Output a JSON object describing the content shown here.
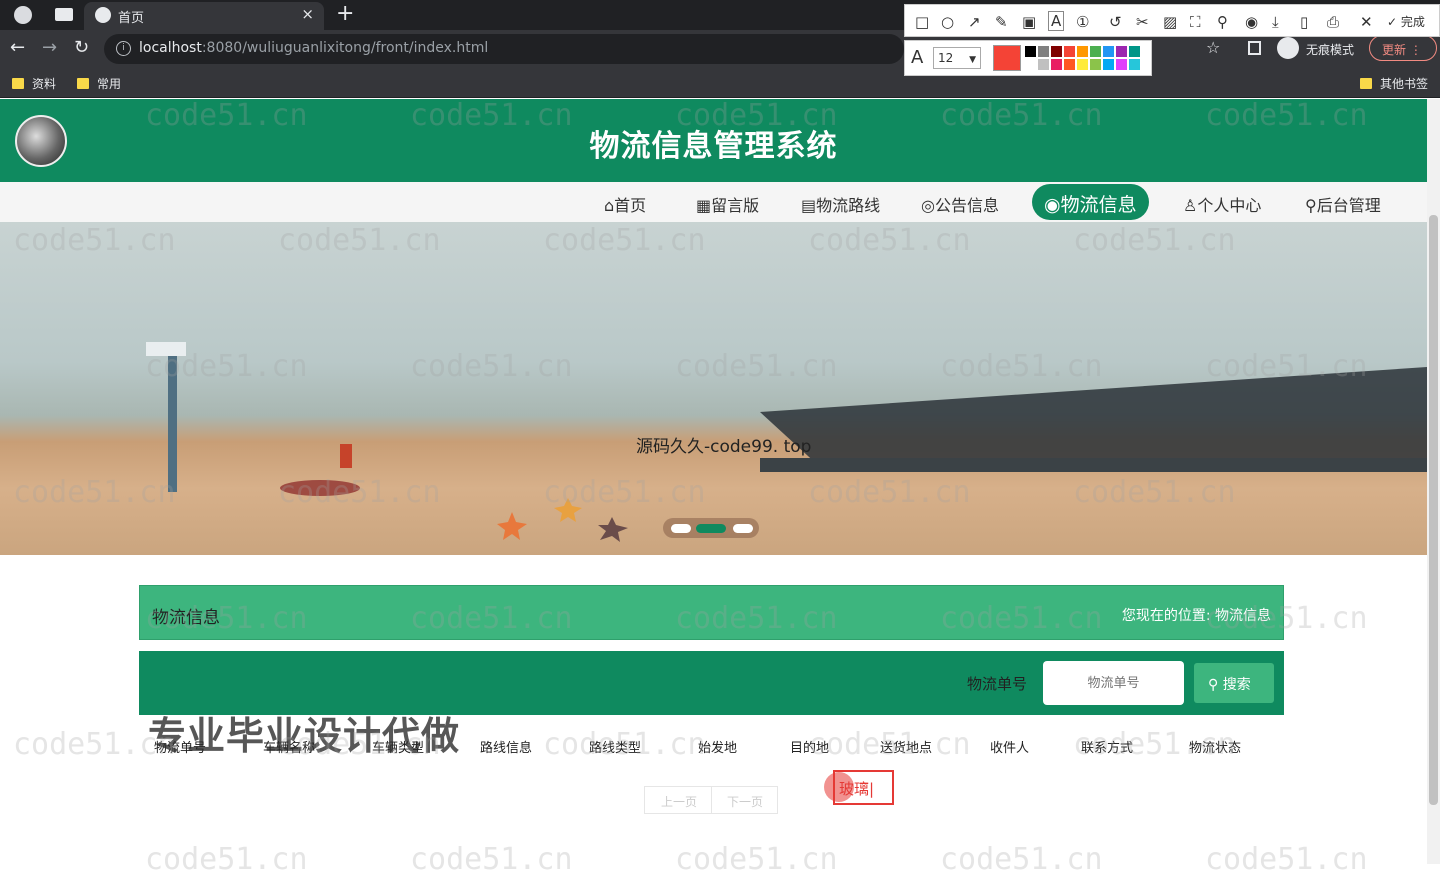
{
  "browser": {
    "tab_title": "首页",
    "url_host": "localhost",
    "url_path": ":8080/wuliuguanlixitong/front/index.html",
    "incognito_label": "无痕模式",
    "update_label": "更新",
    "bookmarks": [
      "资料",
      "常用"
    ],
    "other_bookmarks": "其他书签"
  },
  "screenshot_tool": {
    "done_label": "完成",
    "font_size": "12",
    "current_color": "#f44336",
    "palette": [
      "#000000",
      "#808080",
      "#800000",
      "#f44336",
      "#ff9800",
      "#4caf50",
      "#2196f3",
      "#9c27b0",
      "#009688",
      "#ffffff",
      "#c0c0c0",
      "#e91e63",
      "#ff5722",
      "#ffeb3b",
      "#8bc34a",
      "#03a9f4",
      "#e040fb",
      "#26c6da"
    ]
  },
  "site": {
    "title": "物流信息管理系统",
    "nav": [
      {
        "icon": "home-icon",
        "glyph": "⌂",
        "label": "首页"
      },
      {
        "icon": "board-icon",
        "glyph": "▦",
        "label": "留言版"
      },
      {
        "icon": "route-icon",
        "glyph": "▤",
        "label": "物流路线"
      },
      {
        "icon": "notice-icon",
        "glyph": "◎",
        "label": "公告信息"
      },
      {
        "icon": "globe-icon",
        "glyph": "◉",
        "label": "物流信息"
      },
      {
        "icon": "user-icon",
        "glyph": "♙",
        "label": "个人中心"
      },
      {
        "icon": "link-icon",
        "glyph": "⚲",
        "label": "后台管理"
      }
    ],
    "banner_caption": "源码久久-code99. top"
  },
  "content": {
    "panel_title": "物流信息",
    "breadcrumb": "您现在的位置: 物流信息",
    "search_label": "物流单号",
    "search_placeholder": "物流单号",
    "search_button": "搜索",
    "columns": [
      "物流单号",
      "车辆名称",
      "车辆类型",
      "路线信息",
      "路线类型",
      "始发地",
      "目的地",
      "送货地点",
      "收件人",
      "联系方式",
      "物流状态"
    ],
    "prev": "上一页",
    "next": "下一页",
    "overlay": "专业毕业设计代做",
    "annotation_text": "玻璃"
  },
  "watermark": "code51.cn",
  "colors": {
    "primary": "#0f8a5f",
    "accent": "#3db57e"
  }
}
